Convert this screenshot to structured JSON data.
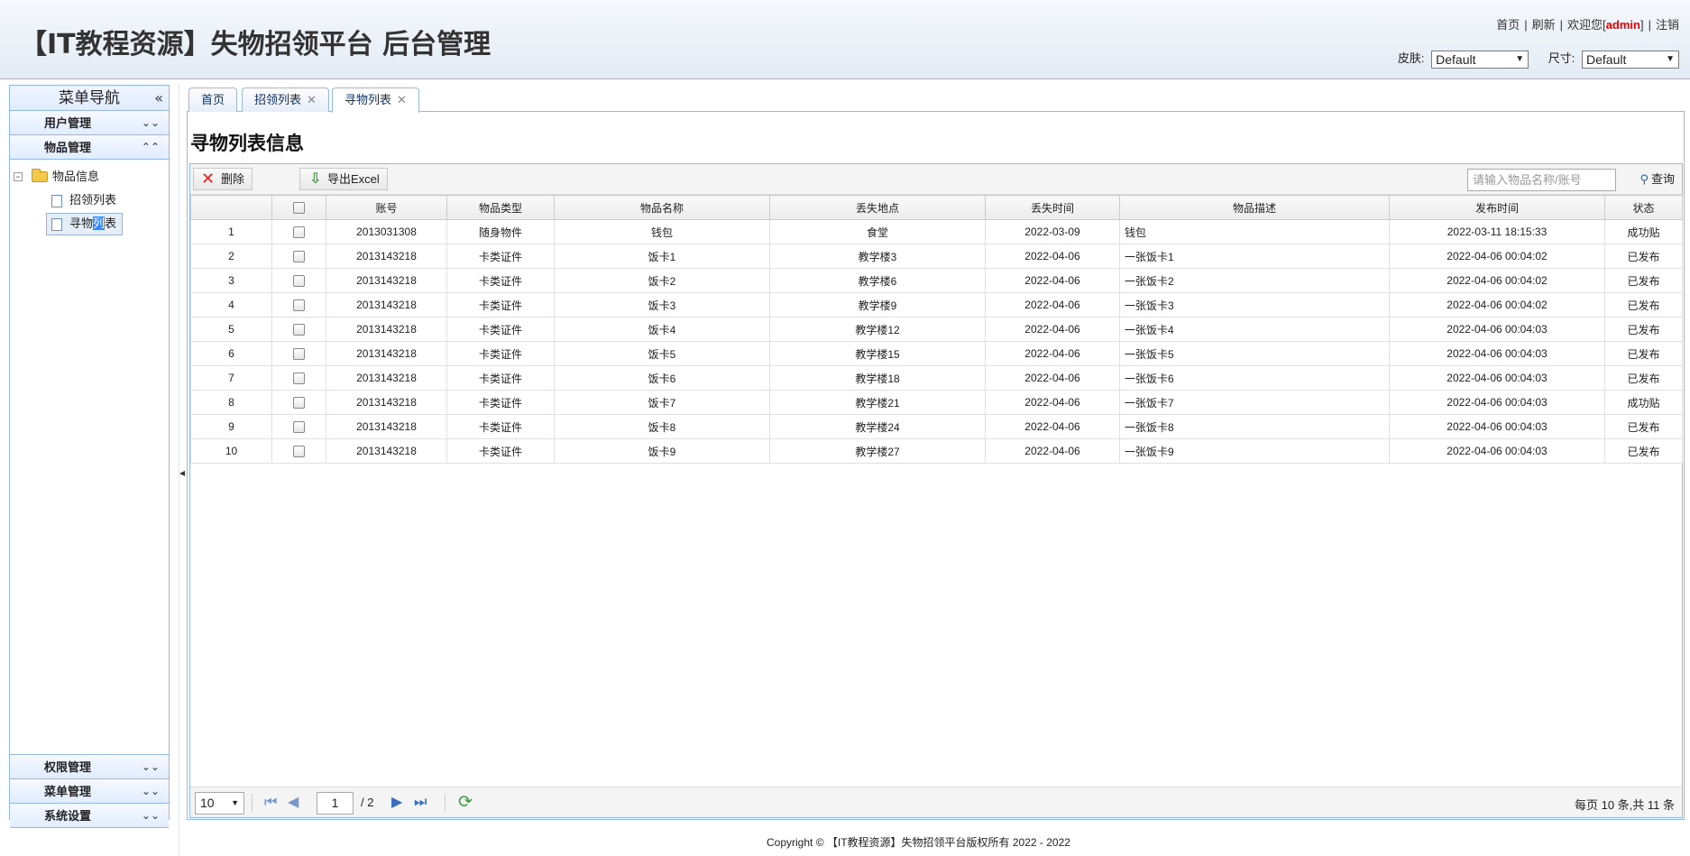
{
  "header": {
    "title": "【IT教程资源】失物招领平台 后台管理",
    "links": {
      "home": "首页",
      "refresh": "刷新",
      "welcome": "欢迎您[",
      "user": "admin",
      "welcome_end": "]",
      "logout": "注销"
    },
    "skin_label": "皮肤:",
    "skin_value": "Default",
    "size_label": "尺寸:",
    "size_value": "Default"
  },
  "sidebar": {
    "title": "菜单导航",
    "collapse_glyph": "«",
    "sections_top": [
      {
        "label": "用户管理",
        "state": "collapsed"
      },
      {
        "label": "物品管理",
        "state": "expanded"
      }
    ],
    "tree": {
      "root": "物品信息",
      "leaves": [
        "招领列表",
        "寻物列表"
      ]
    },
    "sections_bottom": [
      {
        "label": "权限管理",
        "state": "collapsed"
      },
      {
        "label": "菜单管理",
        "state": "collapsed"
      },
      {
        "label": "系统设置",
        "state": "collapsed"
      }
    ]
  },
  "tabs": [
    {
      "label": "首页",
      "closable": false
    },
    {
      "label": "招领列表",
      "closable": true
    },
    {
      "label": "寻物列表",
      "closable": true,
      "active": true
    }
  ],
  "page": {
    "heading": "寻物列表信息",
    "toolbar": {
      "delete_label": "删除",
      "export_label": "导出Excel",
      "search_placeholder": "请输入物品名称/账号",
      "search_label": "查询"
    },
    "columns": [
      "账号",
      "物品类型",
      "物品名称",
      "丢失地点",
      "丢失时间",
      "物品描述",
      "发布时间",
      "状态"
    ],
    "rows": [
      {
        "no": "1",
        "account": "2013031308",
        "type": "随身物件",
        "name": "钱包",
        "place": "食堂",
        "lost_date": "2022-03-09",
        "desc": "钱包",
        "publish_time": "2022-03-11 18:15:33",
        "status": "成功贴"
      },
      {
        "no": "2",
        "account": "2013143218",
        "type": "卡类证件",
        "name": "饭卡1",
        "place": "教学楼3",
        "lost_date": "2022-04-06",
        "desc": "一张饭卡1",
        "publish_time": "2022-04-06 00:04:02",
        "status": "已发布"
      },
      {
        "no": "3",
        "account": "2013143218",
        "type": "卡类证件",
        "name": "饭卡2",
        "place": "教学楼6",
        "lost_date": "2022-04-06",
        "desc": "一张饭卡2",
        "publish_time": "2022-04-06 00:04:02",
        "status": "已发布"
      },
      {
        "no": "4",
        "account": "2013143218",
        "type": "卡类证件",
        "name": "饭卡3",
        "place": "教学楼9",
        "lost_date": "2022-04-06",
        "desc": "一张饭卡3",
        "publish_time": "2022-04-06 00:04:02",
        "status": "已发布"
      },
      {
        "no": "5",
        "account": "2013143218",
        "type": "卡类证件",
        "name": "饭卡4",
        "place": "教学楼12",
        "lost_date": "2022-04-06",
        "desc": "一张饭卡4",
        "publish_time": "2022-04-06 00:04:03",
        "status": "已发布"
      },
      {
        "no": "6",
        "account": "2013143218",
        "type": "卡类证件",
        "name": "饭卡5",
        "place": "教学楼15",
        "lost_date": "2022-04-06",
        "desc": "一张饭卡5",
        "publish_time": "2022-04-06 00:04:03",
        "status": "已发布"
      },
      {
        "no": "7",
        "account": "2013143218",
        "type": "卡类证件",
        "name": "饭卡6",
        "place": "教学楼18",
        "lost_date": "2022-04-06",
        "desc": "一张饭卡6",
        "publish_time": "2022-04-06 00:04:03",
        "status": "已发布"
      },
      {
        "no": "8",
        "account": "2013143218",
        "type": "卡类证件",
        "name": "饭卡7",
        "place": "教学楼21",
        "lost_date": "2022-04-06",
        "desc": "一张饭卡7",
        "publish_time": "2022-04-06 00:04:03",
        "status": "成功贴"
      },
      {
        "no": "9",
        "account": "2013143218",
        "type": "卡类证件",
        "name": "饭卡8",
        "place": "教学楼24",
        "lost_date": "2022-04-06",
        "desc": "一张饭卡8",
        "publish_time": "2022-04-06 00:04:03",
        "status": "已发布"
      },
      {
        "no": "10",
        "account": "2013143218",
        "type": "卡类证件",
        "name": "饭卡9",
        "place": "教学楼27",
        "lost_date": "2022-04-06",
        "desc": "一张饭卡9",
        "publish_time": "2022-04-06 00:04:03",
        "status": "已发布"
      }
    ],
    "pager": {
      "page_size": "10",
      "current_page": "1",
      "total_pages": "/ 2",
      "info": "每页 10 条,共 11 条"
    }
  },
  "footer": {
    "text": "Copyright © 【IT教程资源】失物招领平台版权所有  2022 - 2022"
  },
  "colors": {
    "border_blue": "#95b8e7",
    "admin_red": "#e00000",
    "delete_red": "#e52222",
    "export_green": "#3ba03b",
    "refresh_green": "#3c9b3c"
  },
  "icons": [
    "collapse-left-icon",
    "chevron-down-double-icon",
    "chevron-up-double-icon",
    "folder-open-icon",
    "page-icon",
    "tab-close-icon",
    "delete-x-icon",
    "export-down-arrow-icon",
    "search-icon",
    "first-page-icon",
    "prev-page-icon",
    "next-page-icon",
    "last-page-icon",
    "refresh-icon"
  ]
}
